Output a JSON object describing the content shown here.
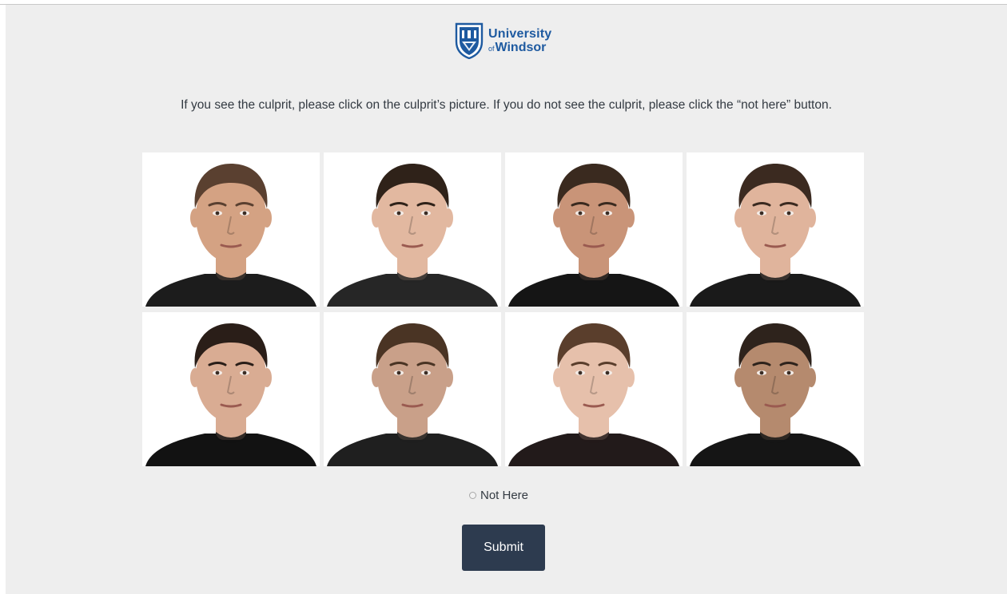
{
  "brand": {
    "line1": "University",
    "of": "of",
    "line2": "Windsor",
    "color": "#1e5aa0"
  },
  "instructions": "If you see the culprit, please click on the culprit’s picture. If you do not see the culprit, please click the “not here” button.",
  "lineup": {
    "photos": [
      {
        "icon": "face-photo-1",
        "skin": "#d4a283",
        "hair": "#5a4030",
        "shirt": "#1c1c1c"
      },
      {
        "icon": "face-photo-2",
        "skin": "#e2b8a0",
        "hair": "#2f2219",
        "shirt": "#262626"
      },
      {
        "icon": "face-photo-3",
        "skin": "#c99478",
        "hair": "#3a2a1f",
        "shirt": "#151515"
      },
      {
        "icon": "face-photo-4",
        "skin": "#e0b49c",
        "hair": "#3b2a20",
        "shirt": "#1a1a1a"
      },
      {
        "icon": "face-photo-5",
        "skin": "#d9ac93",
        "hair": "#2a1e18",
        "shirt": "#121212"
      },
      {
        "icon": "face-photo-6",
        "skin": "#c9a089",
        "hair": "#4a3424",
        "shirt": "#1f1f1f"
      },
      {
        "icon": "face-photo-7",
        "skin": "#e6c0ab",
        "hair": "#5a3e2c",
        "shirt": "#221a1a"
      },
      {
        "icon": "face-photo-8",
        "skin": "#b58a6e",
        "hair": "#2e231c",
        "shirt": "#151515"
      }
    ]
  },
  "not_here": {
    "label": "Not Here"
  },
  "submit": {
    "label": "Submit",
    "color": "#2d3b4f"
  }
}
